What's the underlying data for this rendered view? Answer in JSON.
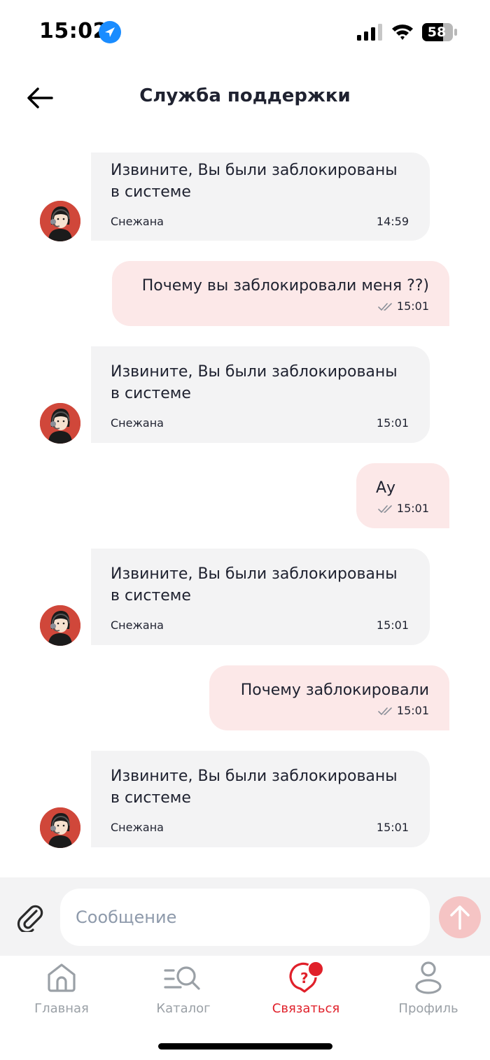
{
  "status_bar": {
    "time": "15:02",
    "battery": "58"
  },
  "header": {
    "title": "Служба поддержки"
  },
  "messages": [
    {
      "direction": "in",
      "text_line1": "Извините, Вы были заблокированы",
      "text_line2": "в системе",
      "sender": "Снежана",
      "time": "14:59"
    },
    {
      "direction": "out",
      "text": "Почему вы заблокировали меня ??)",
      "time": "15:01"
    },
    {
      "direction": "in",
      "text_line1": "Извините, Вы были заблокированы",
      "text_line2": "в системе",
      "sender": "Снежана",
      "time": "15:01"
    },
    {
      "direction": "out",
      "text": "Ау",
      "time": "15:01"
    },
    {
      "direction": "in",
      "text_line1": "Извините, Вы были заблокированы",
      "text_line2": "в системе",
      "sender": "Снежана",
      "time": "15:01"
    },
    {
      "direction": "out",
      "text": "Почему заблокировали",
      "time": "15:01"
    },
    {
      "direction": "in",
      "text_line1": "Извините, Вы были заблокированы",
      "text_line2": "в системе",
      "sender": "Снежана",
      "time": "15:01"
    }
  ],
  "composer": {
    "placeholder": "Сообщение",
    "value": ""
  },
  "tabs": [
    {
      "label": "Главная",
      "icon": "home-icon",
      "active": false
    },
    {
      "label": "Каталог",
      "icon": "catalog-search-icon",
      "active": false
    },
    {
      "label": "Связаться",
      "icon": "support-chat-icon",
      "active": true
    },
    {
      "label": "Профиль",
      "icon": "profile-icon",
      "active": false
    }
  ],
  "colors": {
    "accent": "#e0202a",
    "incoming_bubble": "#f3f3f4",
    "outgoing_bubble": "#fce8e8",
    "send_button": "#f5c4c4"
  }
}
